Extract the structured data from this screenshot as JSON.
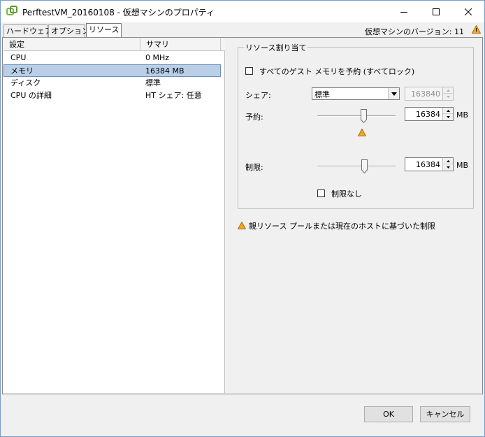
{
  "window": {
    "title": "PerftestVM_20160108 - 仮想マシンのプロパティ",
    "version_label": "仮想マシンのバージョン: 11"
  },
  "tabs": [
    {
      "label": "ハードウェア",
      "selected": false
    },
    {
      "label": "オプション",
      "selected": false
    },
    {
      "label": "リソース",
      "selected": true
    }
  ],
  "resource_list": {
    "headers": {
      "setting": "設定",
      "summary": "サマリ"
    },
    "rows": [
      {
        "setting": "CPU",
        "summary": "0 MHz",
        "selected": false
      },
      {
        "setting": "メモリ",
        "summary": "16384 MB",
        "selected": true
      },
      {
        "setting": "ディスク",
        "summary": "標準",
        "selected": false
      },
      {
        "setting": "CPU の詳細",
        "summary": "HT シェア: 任意",
        "selected": false
      }
    ]
  },
  "allocation": {
    "group_label": "リソース割り当て",
    "reserve_all_label": "すべてのゲスト メモリを予約 (すべてロック)",
    "reserve_all_checked": false,
    "share_label": "シェア:",
    "share_value": "標準",
    "share_number": "163840",
    "reservation_label": "予約:",
    "reservation_value": "16384",
    "reservation_unit": "MB",
    "reservation_slider_fraction": 0.6,
    "limit_label": "制限:",
    "limit_value": "16384",
    "limit_unit": "MB",
    "limit_slider_fraction": 0.61,
    "unlimited_label": "制限なし",
    "unlimited_checked": false
  },
  "note": {
    "text": "親リソース プールまたは現在のホストに基づいた制限"
  },
  "buttons": {
    "ok": "OK",
    "cancel": "キャンセル"
  },
  "colors": {
    "warning": "#f5a623",
    "selection": "#b9cfe8",
    "app_icon": "#7ab648"
  }
}
